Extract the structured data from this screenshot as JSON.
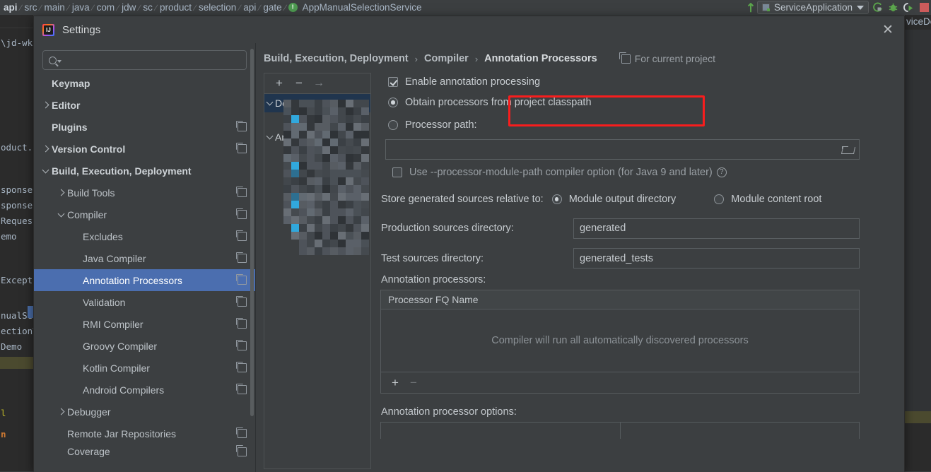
{
  "ide": {
    "breadcrumb": [
      {
        "label": "api",
        "first": true
      },
      {
        "label": "src"
      },
      {
        "label": "main"
      },
      {
        "label": "java"
      },
      {
        "label": "com"
      },
      {
        "label": "jdw"
      },
      {
        "label": "sc"
      },
      {
        "label": "product"
      },
      {
        "label": "selection"
      },
      {
        "label": "api"
      },
      {
        "label": "gate"
      }
    ],
    "breadcrumb_last": "AppManualSelectionService",
    "run_config": "ServiceApplication",
    "toolbar_icons": [
      "rerun-icon",
      "debug-icon",
      "run-with-coverage-icon",
      "stop-icon"
    ],
    "editor_left_lines": [
      "\\jd-wk",
      "oduct.s",
      "sponse",
      "sponse(",
      "Request",
      "emo",
      "Excepti",
      "nualSel",
      "ectionT",
      "Demo",
      "l",
      "n"
    ],
    "editor_right_tab": "viceDe"
  },
  "dialog": {
    "title": "Settings",
    "close_label": "✕",
    "search": {
      "value": "",
      "placeholder": ""
    }
  },
  "sidebar": {
    "items": [
      {
        "label": "Keymap",
        "indent": 0,
        "chevron": "none",
        "bold": true,
        "copy": false,
        "selected": false,
        "clipped": false
      },
      {
        "label": "Editor",
        "indent": 0,
        "chevron": "right",
        "bold": true,
        "copy": false,
        "selected": false,
        "clipped": false
      },
      {
        "label": "Plugins",
        "indent": 0,
        "chevron": "none",
        "bold": true,
        "copy": true,
        "selected": false,
        "clipped": false
      },
      {
        "label": "Version Control",
        "indent": 0,
        "chevron": "right",
        "bold": true,
        "copy": true,
        "selected": false,
        "clipped": false
      },
      {
        "label": "Build, Execution, Deployment",
        "indent": 0,
        "chevron": "down",
        "bold": true,
        "copy": false,
        "selected": false,
        "clipped": false
      },
      {
        "label": "Build Tools",
        "indent": 1,
        "chevron": "right",
        "bold": false,
        "copy": true,
        "selected": false,
        "clipped": false
      },
      {
        "label": "Compiler",
        "indent": 1,
        "chevron": "down",
        "bold": false,
        "copy": true,
        "selected": false,
        "clipped": false
      },
      {
        "label": "Excludes",
        "indent": 2,
        "chevron": "none",
        "bold": false,
        "copy": true,
        "selected": false,
        "clipped": false
      },
      {
        "label": "Java Compiler",
        "indent": 2,
        "chevron": "none",
        "bold": false,
        "copy": true,
        "selected": false,
        "clipped": false
      },
      {
        "label": "Annotation Processors",
        "indent": 2,
        "chevron": "none",
        "bold": false,
        "copy": true,
        "selected": true,
        "clipped": false
      },
      {
        "label": "Validation",
        "indent": 2,
        "chevron": "none",
        "bold": false,
        "copy": true,
        "selected": false,
        "clipped": false
      },
      {
        "label": "RMI Compiler",
        "indent": 2,
        "chevron": "none",
        "bold": false,
        "copy": true,
        "selected": false,
        "clipped": false
      },
      {
        "label": "Groovy Compiler",
        "indent": 2,
        "chevron": "none",
        "bold": false,
        "copy": true,
        "selected": false,
        "clipped": false
      },
      {
        "label": "Kotlin Compiler",
        "indent": 2,
        "chevron": "none",
        "bold": false,
        "copy": true,
        "selected": false,
        "clipped": false
      },
      {
        "label": "Android Compilers",
        "indent": 2,
        "chevron": "none",
        "bold": false,
        "copy": true,
        "selected": false,
        "clipped": false
      },
      {
        "label": "Debugger",
        "indent": 1,
        "chevron": "right",
        "bold": false,
        "copy": false,
        "selected": false,
        "clipped": false
      },
      {
        "label": "Remote Jar Repositories",
        "indent": 1,
        "chevron": "none",
        "bold": false,
        "copy": true,
        "selected": false,
        "clipped": false
      },
      {
        "label": "Coverage",
        "indent": 1,
        "chevron": "none",
        "bold": false,
        "copy": true,
        "selected": false,
        "clipped": true
      }
    ]
  },
  "breadcrumb": {
    "parts": [
      "Build, Execution, Deployment",
      "Compiler",
      "Annotation Processors"
    ],
    "separator": "›",
    "for_current_project": "For current project"
  },
  "profiles": {
    "toolbar": {
      "add": "+",
      "remove": "−",
      "move": "→"
    },
    "rows": [
      {
        "label": "Default",
        "chevron": "down",
        "selected": true
      },
      {
        "label": "Ann",
        "chevron": "down",
        "selected": false
      }
    ]
  },
  "form": {
    "enable_annotation_processing": {
      "label": "Enable annotation processing",
      "checked": true
    },
    "obtain_from_classpath": {
      "label": "Obtain processors from project classpath",
      "selected": true
    },
    "processor_path": {
      "label": "Processor path:",
      "selected": false,
      "value": ""
    },
    "use_module_path": {
      "label": "Use --processor-module-path compiler option (for Java 9 and later)",
      "checked": false,
      "help": "?"
    },
    "store_relative_label": "Store generated sources relative to:",
    "store_options": [
      {
        "label": "Module output directory",
        "selected": true
      },
      {
        "label": "Module content root",
        "selected": false
      }
    ],
    "production_sources": {
      "label": "Production sources directory:",
      "value": "generated"
    },
    "test_sources": {
      "label": "Test sources directory:",
      "value": "generated_tests"
    },
    "processors_section_label": "Annotation processors:",
    "processors_table": {
      "columns": [
        "Processor FQ Name"
      ],
      "rows": [],
      "empty_message": "Compiler will run all automatically discovered processors",
      "footer": {
        "add": "+",
        "remove": "−"
      }
    },
    "options_section_label": "Annotation processor options:"
  },
  "annotation": {
    "highlight_color": "#f81d1d",
    "highlight_target": "enable-annotation-processing-checkbox"
  }
}
